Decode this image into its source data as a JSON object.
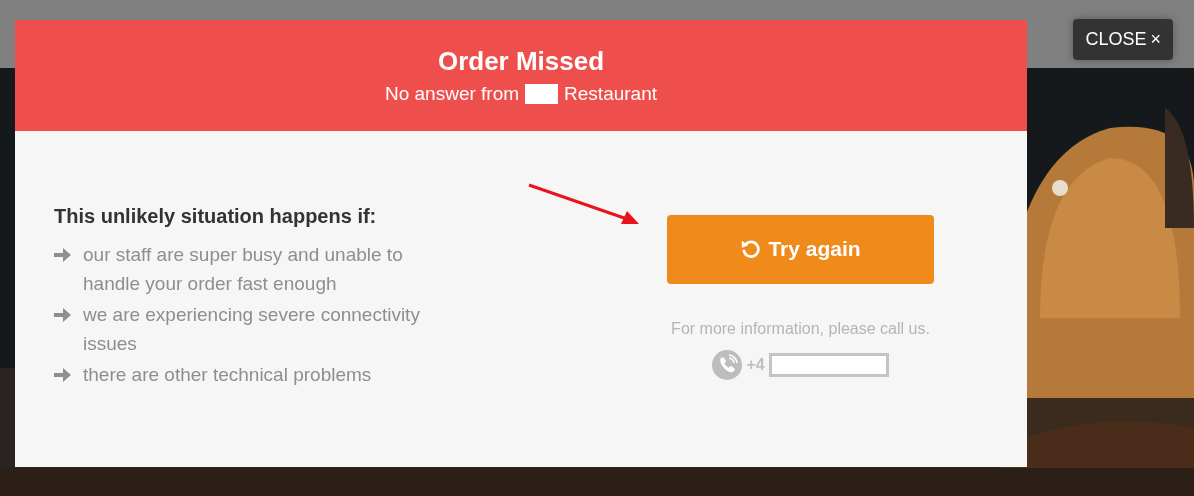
{
  "close_button": {
    "label": "CLOSE",
    "icon": "×"
  },
  "modal": {
    "title": "Order Missed",
    "subtitle_before": "No answer from",
    "subtitle_after": "Restaurant",
    "reasons_heading": "This unlikely situation happens if:",
    "reasons": [
      "our staff are super busy and unable to handle your order fast enough",
      "we are experiencing severe connectivity issues",
      "there are other technical problems"
    ],
    "try_again_button": {
      "label": "Try again"
    },
    "info_text": "For more information, please call us.",
    "phone_prefix": "+4"
  }
}
